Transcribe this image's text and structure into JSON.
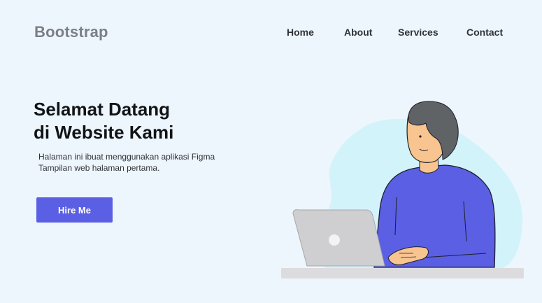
{
  "brand": "Bootstrap",
  "nav": [
    "Home",
    "About",
    "Services",
    "Contact"
  ],
  "hero": {
    "title_line1": "Selamat Datang",
    "title_line2": "di Website Kami",
    "desc_line1": "Halaman ini ibuat menggunakan aplikasi Figma",
    "desc_line2": "Tampilan web halaman pertama.",
    "button": "Hire Me"
  },
  "colors": {
    "background": "#eef6fd",
    "accent": "#5b5fe3",
    "blob": "#d3f3fb",
    "shirt": "#5b5fe3",
    "hair": "#5f6366",
    "skin": "#f8c48f",
    "laptop": "#cfcfd2",
    "desk": "#dcdcde"
  },
  "illustration": "person-working-on-laptop"
}
